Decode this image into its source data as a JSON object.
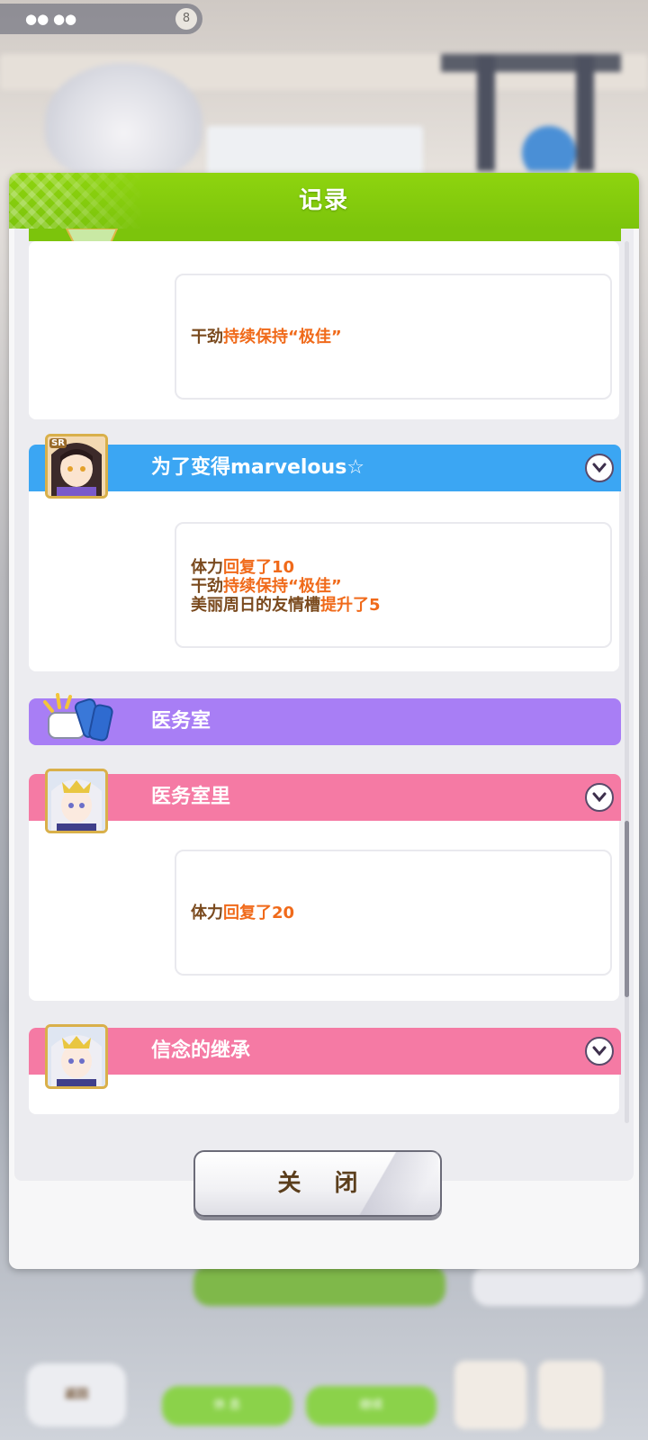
{
  "background": {
    "top_badge": "●● ●●",
    "top_badge_count": "8",
    "bottom_left_button": "返回",
    "bottom_center_left_button": "休 息",
    "bottom_center_right_button": "继续"
  },
  "dialog": {
    "title": "记录",
    "close_label": "关 闭",
    "accent_color": "#7cc40c"
  },
  "records": [
    {
      "type": "partial-top",
      "band_color": "#7cc40c",
      "effects": [
        [
          {
            "text": "干劲",
            "style": "brown"
          },
          {
            "text": "持续保持“极佳”",
            "style": "orange"
          }
        ]
      ]
    },
    {
      "type": "event",
      "title": "为了变得marvelous☆",
      "band_color": "#3ba6f3",
      "portrait_badge": "SR",
      "portrait_icon": "character-portrait-icon",
      "effects": [
        [
          {
            "text": "体力",
            "style": "brown"
          },
          {
            "text": "回复了10",
            "style": "orange"
          }
        ],
        [
          {
            "text": "干劲",
            "style": "brown"
          },
          {
            "text": "持续保持“极佳”",
            "style": "orange"
          }
        ],
        [
          {
            "text": "美丽周日的友情槽",
            "style": "brown"
          },
          {
            "text": "提升了5",
            "style": "orange"
          }
        ]
      ]
    },
    {
      "type": "section",
      "title": "医务室",
      "band_color": "#a87ef5",
      "icon": "infirmary-icon"
    },
    {
      "type": "event",
      "title": "医务室里",
      "band_color": "#f57aa4",
      "portrait_icon": "character-portrait-icon",
      "effects": [
        [
          {
            "text": "体力",
            "style": "brown"
          },
          {
            "text": "回复了20",
            "style": "orange"
          }
        ]
      ]
    },
    {
      "type": "event",
      "title": "信念的继承",
      "band_color": "#f57aa4",
      "portrait_icon": "character-portrait-icon",
      "effects": []
    }
  ]
}
